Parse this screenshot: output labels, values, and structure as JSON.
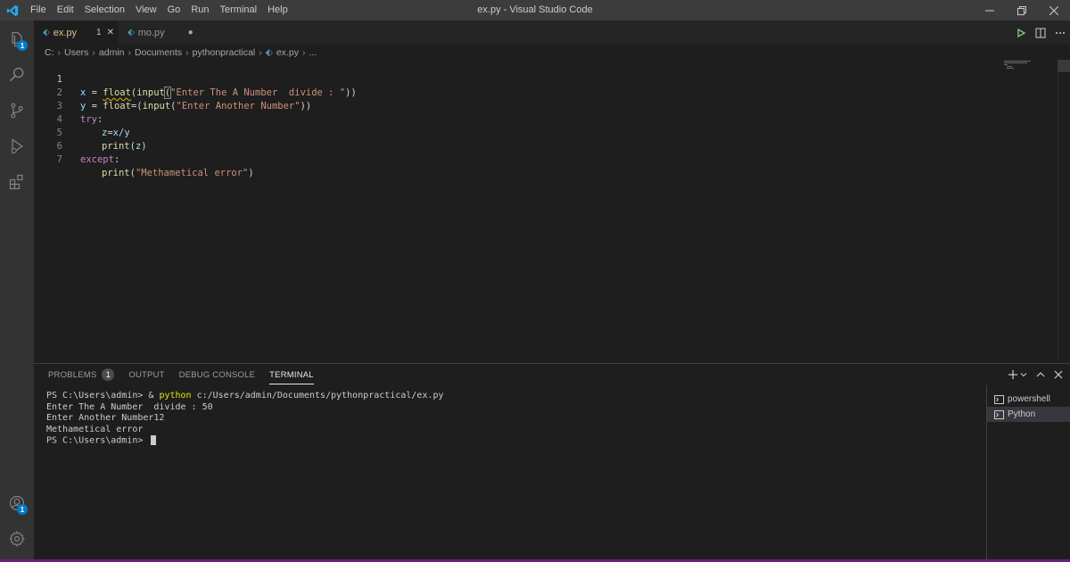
{
  "titlebar": {
    "menu": [
      "File",
      "Edit",
      "Selection",
      "View",
      "Go",
      "Run",
      "Terminal",
      "Help"
    ],
    "title": "ex.py - Visual Studio Code"
  },
  "activitybar": {
    "explorer_badge": "1",
    "accounts_badge": "1"
  },
  "tabs": [
    {
      "label": "ex.py",
      "problems": "1",
      "close": "✕"
    },
    {
      "label": "mo.py",
      "dirty": "●"
    }
  ],
  "breadcrumb": {
    "parts": [
      "C:",
      "Users",
      "admin",
      "Documents",
      "pythonpractical",
      "ex.py",
      "..."
    ]
  },
  "editor": {
    "lines": [
      {
        "n": "1"
      },
      {
        "n": "2"
      },
      {
        "n": "3"
      },
      {
        "n": "4"
      },
      {
        "n": "5"
      },
      {
        "n": "6"
      },
      {
        "n": "7"
      }
    ],
    "code": {
      "l1_var": "x",
      "l1_eq": " = ",
      "l1_fn": "float",
      "l1_p1": "(",
      "l1_fn2": "input",
      "l1_p2": "(",
      "l1_str": "\"Enter The A Number  divide : \"",
      "l1_p3": "))",
      "l2_var": "y",
      "l2_eq": " = ",
      "l2_fn": "float",
      "l2_p1": "=(",
      "l2_fn2": "input",
      "l2_p2": "(",
      "l2_str": "\"Enter Another Number\"",
      "l2_p3": "))",
      "l3_kw": "try",
      "l3_c": ":",
      "l4_a": "z",
      "l4_b": "=",
      "l4_c": "x",
      "l4_d": "/",
      "l4_e": "y",
      "l5_fn": "print",
      "l5_p1": "(",
      "l5_v": "z",
      "l5_p2": ")",
      "l6_kw": "except",
      "l6_c": ":",
      "l7_fn": "print",
      "l7_p1": "(",
      "l7_str": "\"Methametical error\"",
      "l7_p2": ")"
    }
  },
  "panel": {
    "tabs": [
      "PROBLEMS",
      "OUTPUT",
      "DEBUG CONSOLE",
      "TERMINAL"
    ],
    "problems_count": "1",
    "active_tab": "TERMINAL",
    "terminal": {
      "l1_prompt": "PS C:\\Users\\admin> & ",
      "l1_cmd": "python",
      "l1_rest": " c:/Users/admin/Documents/pythonpractical/ex.py",
      "l2": "Enter The A Number  divide : 50",
      "l3": "Enter Another Number12",
      "l4": "Methametical error",
      "l5": "PS C:\\Users\\admin> "
    },
    "terminals": [
      "powershell",
      "Python"
    ],
    "selected_terminal": "Python"
  },
  "colors": {
    "accent": "#007acc",
    "statusbar": "#68217a",
    "keyword": "#c586c0",
    "function": "#dcdcaa",
    "string": "#ce9178",
    "variable": "#9cdcfe"
  }
}
